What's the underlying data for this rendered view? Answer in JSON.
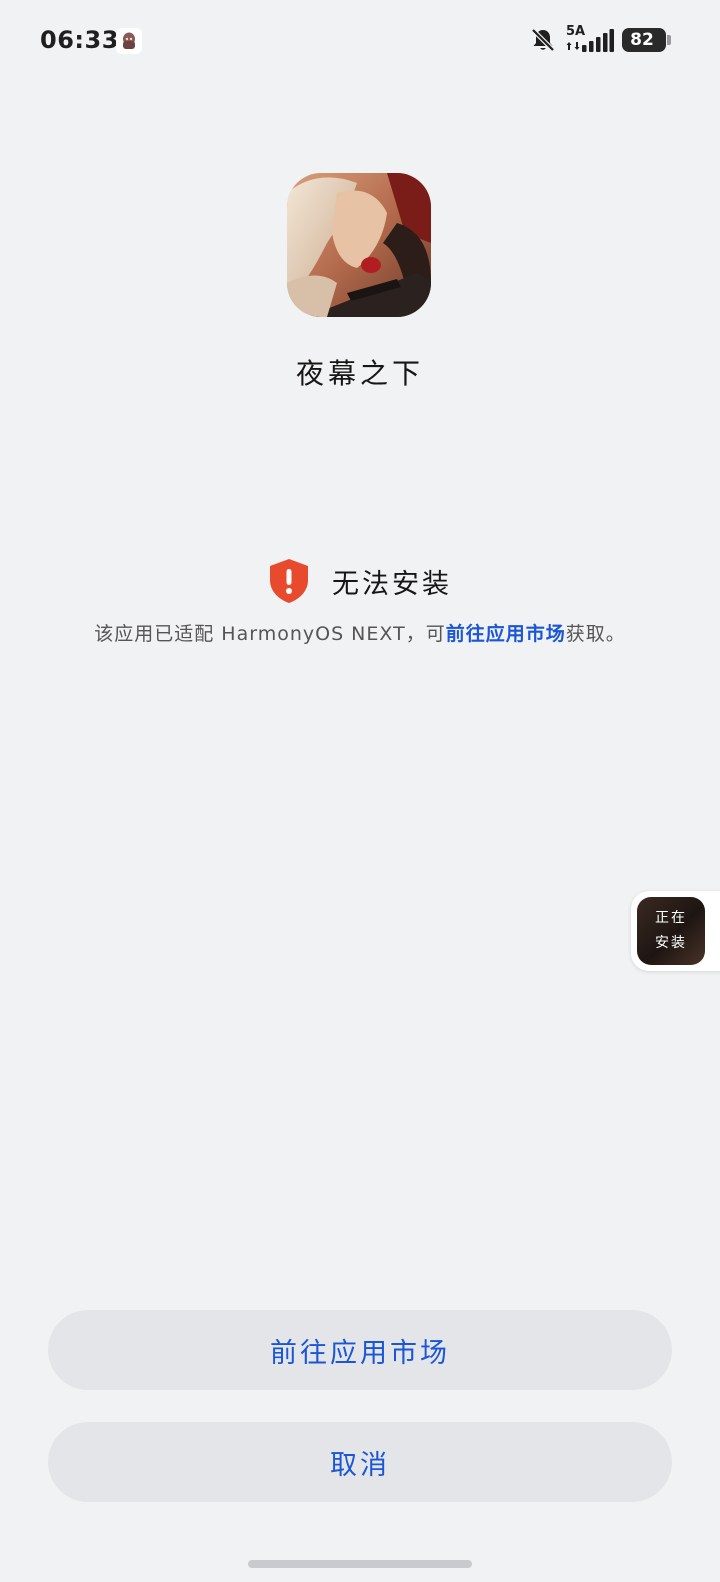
{
  "status_bar": {
    "time": "06:33",
    "network": "5A",
    "battery": "82",
    "icons": [
      "app-notification-icon",
      "bell-off-icon",
      "data-arrows-icon",
      "signal-icon",
      "battery-icon"
    ]
  },
  "app": {
    "name": "夜幕之下",
    "icon": "app-icon-artwork"
  },
  "install_status": {
    "title": "无法安装",
    "icon": "shield-alert-icon",
    "description_prefix": "该应用已适配 HarmonyOS NEXT，可",
    "description_link": "前往应用市场",
    "description_suffix": "获取。"
  },
  "floating_chip": {
    "label": "正在安装"
  },
  "actions": {
    "go_market": "前往应用市场",
    "cancel": "取消"
  },
  "colors": {
    "accent": "#1a56d6",
    "alert": "#e84a2e",
    "background": "#f1f2f4",
    "button_bg": "#e4e5e8"
  }
}
